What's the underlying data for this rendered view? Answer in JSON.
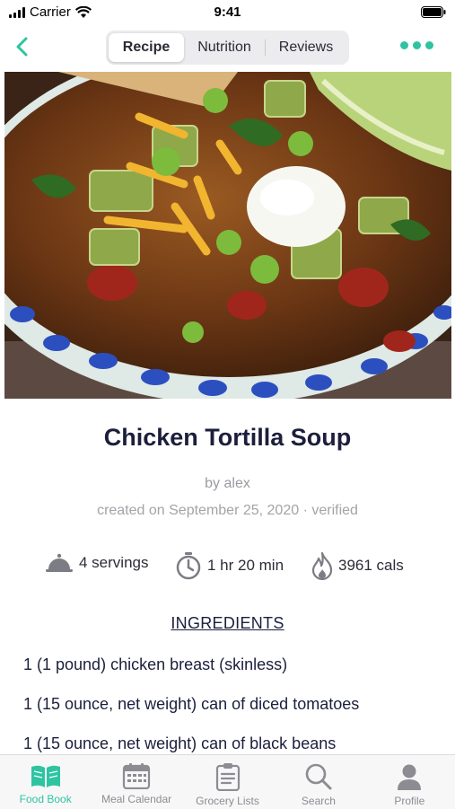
{
  "status_bar": {
    "carrier": "Carrier",
    "time": "9:41"
  },
  "nav": {
    "tabs": [
      {
        "label": "Recipe",
        "active": true
      },
      {
        "label": "Nutrition",
        "active": false
      },
      {
        "label": "Reviews",
        "active": false
      }
    ],
    "back_icon": "chevron-left-icon",
    "more_icon": "ellipsis-icon"
  },
  "recipe": {
    "title": "Chicken Tortilla Soup",
    "author": "by alex",
    "created": "created on September 25, 2020 · verified",
    "stats": {
      "servings": "4 servings",
      "time": "1 hr 20 min",
      "calories": "3961 cals"
    },
    "ingredients_heading": "INGREDIENTS",
    "ingredients": [
      "1 (1 pound) chicken breast (skinless)",
      "1 (15 ounce, net weight) can of diced tomatoes",
      "1 (15 ounce, net weight) can of black beans"
    ]
  },
  "tab_bar": {
    "items": [
      {
        "label": "Food Book",
        "icon": "book-icon",
        "active": true
      },
      {
        "label": "Meal Calendar",
        "icon": "calendar-icon",
        "active": false
      },
      {
        "label": "Grocery Lists",
        "icon": "clipboard-icon",
        "active": false
      },
      {
        "label": "Search",
        "icon": "search-icon",
        "active": false
      },
      {
        "label": "Profile",
        "icon": "person-icon",
        "active": false
      }
    ]
  },
  "colors": {
    "accent": "#2ec4a1",
    "title": "#1b1f3b",
    "muted": "#9a9aa0"
  }
}
